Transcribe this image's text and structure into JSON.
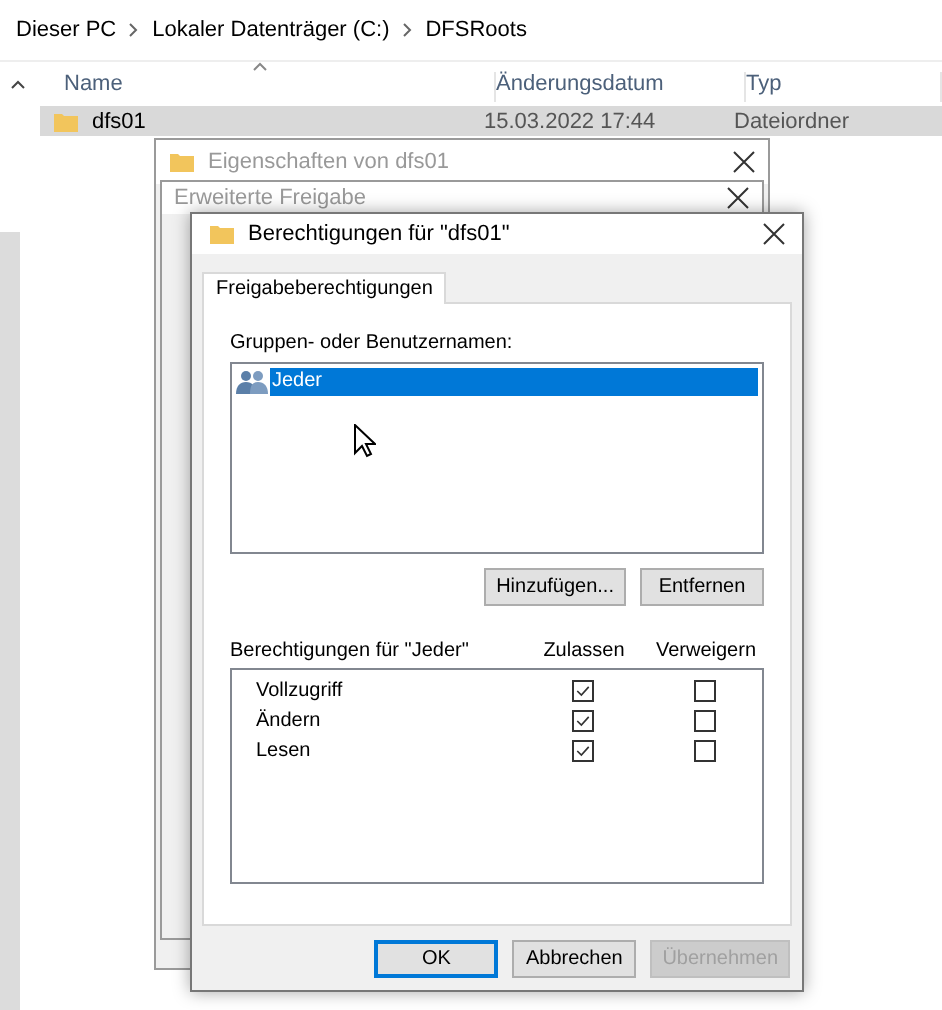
{
  "breadcrumb": [
    "Dieser PC",
    "Lokaler Datenträger (C:)",
    "DFSRoots"
  ],
  "file_list": {
    "columns": [
      "Name",
      "Änderungsdatum",
      "Typ"
    ],
    "rows": [
      {
        "name": "dfs01",
        "modified": "15.03.2022 17:44",
        "type": "Dateiordner",
        "selected": true
      }
    ]
  },
  "background_windows": [
    {
      "title": "Eigenschaften von dfs01"
    },
    {
      "title": "Erweiterte Freigabe"
    }
  ],
  "dialog": {
    "title": "Berechtigungen für \"dfs01\"",
    "tabs": [
      {
        "label": "Freigabeberechtigungen",
        "selected": true
      }
    ],
    "groups_label": "Gruppen- oder Benutzernamen:",
    "groups": [
      {
        "name": "Jeder",
        "selected": true
      }
    ],
    "group_buttons": [
      "Hinzufügen...",
      "Entfernen"
    ],
    "permissions_label": "Berechtigungen für \"Jeder\"",
    "permission_columns": [
      "Zulassen",
      "Verweigern"
    ],
    "permissions": [
      {
        "name": "Vollzugriff",
        "allow": true,
        "deny": false
      },
      {
        "name": "Ändern",
        "allow": true,
        "deny": false
      },
      {
        "name": "Lesen",
        "allow": true,
        "deny": false
      }
    ],
    "buttons": [
      {
        "label": "OK",
        "default": true,
        "disabled": false
      },
      {
        "label": "Abbrechen",
        "default": false,
        "disabled": false
      },
      {
        "label": "Übernehmen",
        "default": false,
        "disabled": true
      }
    ]
  }
}
